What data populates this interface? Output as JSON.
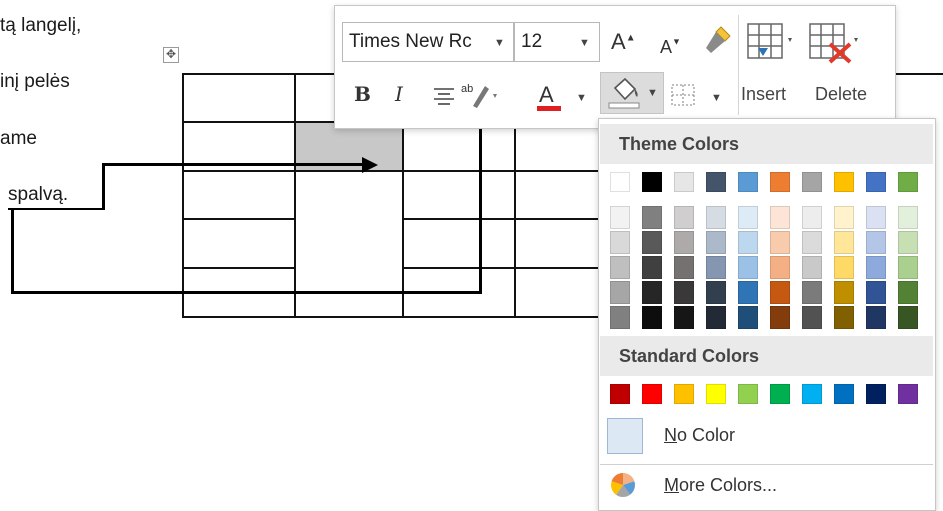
{
  "doc": {
    "lines": [
      "tą langelį,",
      "inį pelės",
      "ame",
      "spalvą."
    ]
  },
  "toolbar": {
    "font_name": "Times New Rc",
    "font_size": "12",
    "bold_label": "B",
    "italic_label": "I",
    "font_color_label": "A",
    "grow_font_label": "A",
    "shrink_font_label": "A",
    "insert_label": "Insert",
    "delete_label": "Delete"
  },
  "color_menu": {
    "theme_header": "Theme Colors",
    "standard_header": "Standard Colors",
    "no_color_label": "No Color",
    "more_colors_label": "More Colors...",
    "theme_top_row": [
      "#FFFFFF",
      "#000000",
      "#E7E6E6",
      "#44546A",
      "#5B9BD5",
      "#ED7D31",
      "#A5A5A5",
      "#FFC000",
      "#4472C4",
      "#70AD47"
    ],
    "theme_shades": [
      [
        "#F2F2F2",
        "#D9D9D9",
        "#BFBFBF",
        "#A6A6A6",
        "#808080"
      ],
      [
        "#808080",
        "#595959",
        "#404040",
        "#262626",
        "#0D0D0D"
      ],
      [
        "#D0CECE",
        "#AEAAAA",
        "#757171",
        "#3A3838",
        "#171616"
      ],
      [
        "#D6DCE4",
        "#ACB9CA",
        "#8496B0",
        "#323F4F",
        "#222A35"
      ],
      [
        "#DDEBF7",
        "#BDD7EE",
        "#9BC2E6",
        "#2F75B5",
        "#1F4E78"
      ],
      [
        "#FCE4D6",
        "#F8CBAD",
        "#F4B084",
        "#C65911",
        "#833C0C"
      ],
      [
        "#EDEDED",
        "#DBDBDB",
        "#C9C9C9",
        "#7B7B7B",
        "#525252"
      ],
      [
        "#FFF2CC",
        "#FFE699",
        "#FFD966",
        "#BF8F00",
        "#806000"
      ],
      [
        "#D9E1F2",
        "#B4C6E7",
        "#8EA9DB",
        "#305496",
        "#203764"
      ],
      [
        "#E2EFDA",
        "#C6E0B4",
        "#A9D08E",
        "#548235",
        "#375623"
      ]
    ],
    "standard_colors": [
      "#C00000",
      "#FF0000",
      "#FFC000",
      "#FFFF00",
      "#92D050",
      "#00B050",
      "#00B0F0",
      "#0070C0",
      "#002060",
      "#7030A0"
    ],
    "no_color_fill": "#DDE8F5",
    "header_bg": "#EAEAEA"
  },
  "icons": {
    "move_handle": "table-move-handle-icon",
    "shading": "paint-bucket-icon",
    "format_painter": "format-painter-icon",
    "more_colors": "color-wheel-icon"
  }
}
